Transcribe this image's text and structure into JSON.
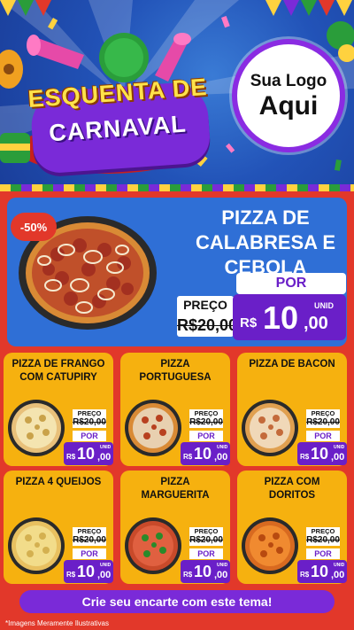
{
  "header": {
    "title_line1": "ESQUENTA DE",
    "title_line2": "CARNAVAL",
    "logo_line1": "Sua Logo",
    "logo_line2": "Aqui"
  },
  "featured": {
    "discount": "-50%",
    "name_lines": [
      "PIZZA DE",
      "CALABRESA E",
      "CEBOLA"
    ],
    "por_label": "POR",
    "preco_label": "PREÇO",
    "old_price": "R$20,00",
    "currency": "R$",
    "price_int": "10",
    "price_dec": ",00",
    "unit": "UNID"
  },
  "products": [
    {
      "name": "PIZZA DE FRANGO\nCOM CATUPIRY",
      "preco_label": "PREÇO",
      "old_price": "R$20,00",
      "por_label": "POR",
      "currency": "R$",
      "price_int": "10",
      "price_dec": ",00",
      "unit": "UNID"
    },
    {
      "name": "PIZZA\nPORTUGUESA",
      "preco_label": "PREÇO",
      "old_price": "R$20,00",
      "por_label": "POR",
      "currency": "R$",
      "price_int": "10",
      "price_dec": ",00",
      "unit": "UNID"
    },
    {
      "name": "PIZZA DE BACON",
      "preco_label": "PREÇO",
      "old_price": "R$20,00",
      "por_label": "POR",
      "currency": "R$",
      "price_int": "10",
      "price_dec": ",00",
      "unit": "UNID"
    },
    {
      "name": "PIZZA 4 QUEIJOS",
      "preco_label": "PREÇO",
      "old_price": "R$20,00",
      "por_label": "POR",
      "currency": "R$",
      "price_int": "10",
      "price_dec": ",00",
      "unit": "UNID"
    },
    {
      "name": "PIZZA\nMARGUERITA",
      "preco_label": "PREÇO",
      "old_price": "R$20,00",
      "por_label": "POR",
      "currency": "R$",
      "price_int": "10",
      "price_dec": ",00",
      "unit": "UNID"
    },
    {
      "name": "PIZZA COM\nDORITOS",
      "preco_label": "PREÇO",
      "old_price": "R$20,00",
      "por_label": "POR",
      "currency": "R$",
      "price_int": "10",
      "price_dec": ",00",
      "unit": "UNID"
    }
  ],
  "cta": {
    "label": "Crie seu encarte com este tema!"
  },
  "footer": {
    "disclaimer": "*Imagens Meramente Ilustrativas"
  },
  "colors": {
    "hero_blue": "#2f6fd6",
    "panel_red": "#e2382a",
    "card_yellow": "#f6b10f",
    "accent_purple": "#6a1fc8",
    "title_yellow": "#ffe24a"
  }
}
